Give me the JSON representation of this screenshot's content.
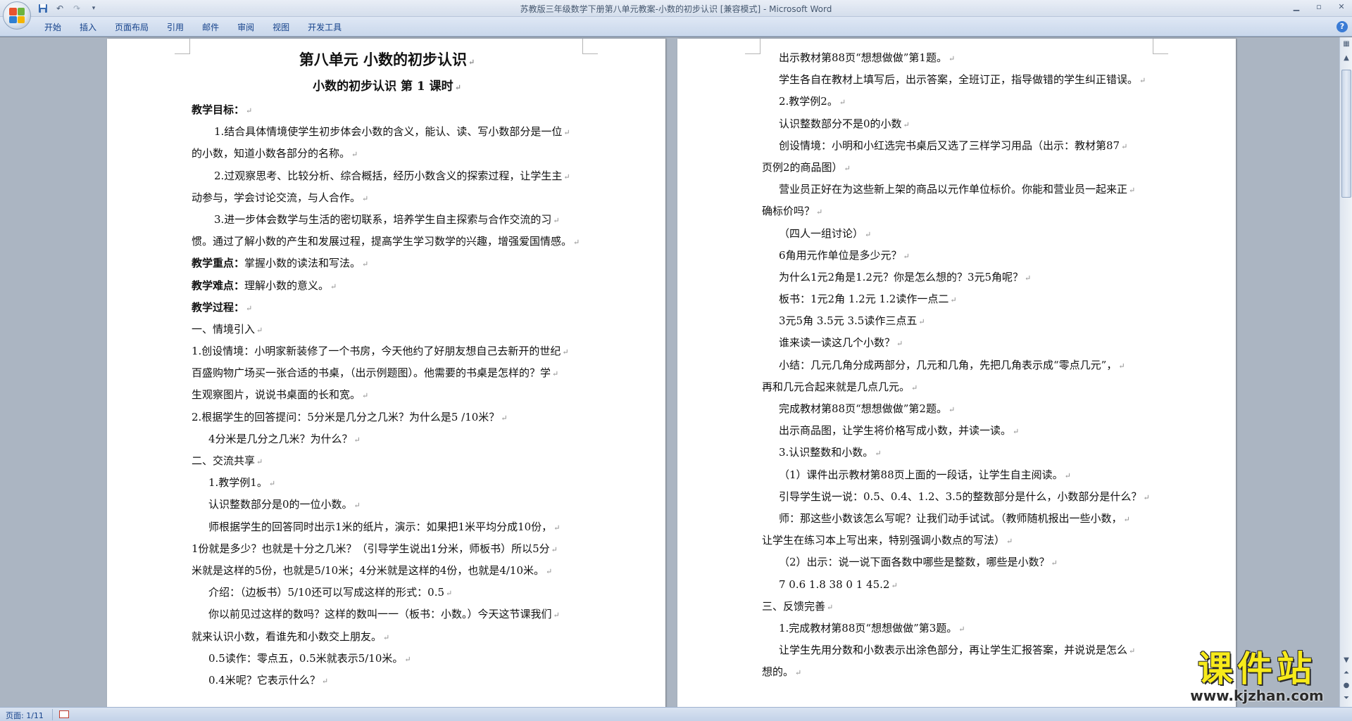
{
  "window": {
    "title": "苏教版三年级数学下册第八单元教案-小数的初步认识 [兼容模式] - Microsoft Word"
  },
  "qat": {
    "save_icon": "save-icon",
    "undo_icon": "undo-icon",
    "redo_icon": "redo-icon",
    "customize_icon": "chevron-down-icon"
  },
  "ribbon": {
    "tabs": [
      "开始",
      "插入",
      "页面布局",
      "引用",
      "邮件",
      "审阅",
      "视图",
      "开发工具"
    ]
  },
  "left_page": {
    "title": "第八单元  小数的初步认识",
    "subtitle": "小数的初步认识  第 1 课时",
    "lines": [
      {
        "text": "教学目标：",
        "style": "b"
      },
      {
        "text": "1.结合具体情境使学生初步体会小数的含义，能认、读、写小数部分是一位",
        "style": "ind2"
      },
      {
        "text": "的小数，知道小数各部分的名称。",
        "style": ""
      },
      {
        "text": "2.过观察思考、比较分析、综合概括，经历小数含义的探索过程，让学生主",
        "style": "ind2"
      },
      {
        "text": "动参与，学会讨论交流，与人合作。",
        "style": ""
      },
      {
        "text": "3.进一步体会数学与生活的密切联系，培养学生自主探索与合作交流的习",
        "style": "ind2"
      },
      {
        "text": "惯。通过了解小数的产生和发展过程，提高学生学习数学的兴趣，增强爱国情感。",
        "style": ""
      },
      {
        "text": "教学重点：掌握小数的读法和写法。",
        "style": "lead",
        "lead": "教学重点：",
        "rest": "掌握小数的读法和写法。"
      },
      {
        "text": "教学难点：理解小数的意义。",
        "style": "lead",
        "lead": "教学难点：",
        "rest": "理解小数的意义。"
      },
      {
        "text": "教学过程：",
        "style": "b"
      },
      {
        "text": "一、情境引入",
        "style": ""
      },
      {
        "text": "1.创设情境：小明家新装修了一个书房，今天他约了好朋友想自己去新开的世纪",
        "style": ""
      },
      {
        "text": "百盛购物广场买一张合适的书桌，（出示例题图）。他需要的书桌是怎样的？学",
        "style": ""
      },
      {
        "text": "生观察图片，说说书桌面的长和宽。",
        "style": ""
      },
      {
        "text": "2.根据学生的回答提问：5分米是几分之几米？为什么是5 /10米？",
        "style": ""
      },
      {
        "text": "4分米是几分之几米？为什么？",
        "style": "ind"
      },
      {
        "text": "二、交流共享",
        "style": ""
      },
      {
        "text": "1.教学例1。",
        "style": "ind"
      },
      {
        "text": "认识整数部分是0的一位小数。",
        "style": "ind"
      },
      {
        "text": "师根据学生的回答同时出示1米的纸片，演示：如果把1米平均分成10份，",
        "style": "ind"
      },
      {
        "text": "1份就是多少？也就是十分之几米？（引导学生说出1分米，师板书）所以5分",
        "style": ""
      },
      {
        "text": "米就是这样的5份，也就是5/10米；4分米就是这样的4份，也就是4/10米。",
        "style": ""
      },
      {
        "text": "介绍：（边板书）5/10还可以写成这样的形式：0.5",
        "style": "ind"
      },
      {
        "text": "你以前见过这样的数吗？这样的数叫一一（板书：小数。）今天这节课我们",
        "style": "ind"
      },
      {
        "text": "就来认识小数，看谁先和小数交上朋友。",
        "style": ""
      },
      {
        "text": "0.5读作：零点五，0.5米就表示5/10米。",
        "style": "ind"
      },
      {
        "text": "0.4米呢？它表示什么？",
        "style": "ind"
      }
    ]
  },
  "right_page": {
    "lines": [
      {
        "text": "出示教材第88页“想想做做”第1题。",
        "style": "ind"
      },
      {
        "text": "学生各自在教材上填写后，出示答案，全班订正，指导做错的学生纠正错误。",
        "style": "ind"
      },
      {
        "text": "2.教学例2。",
        "style": "ind"
      },
      {
        "text": "认识整数部分不是0的小数",
        "style": "ind"
      },
      {
        "text": "创设情境：小明和小红选完书桌后又选了三样学习用品（出示：教材第87",
        "style": "ind"
      },
      {
        "text": "页例2的商品图）",
        "style": ""
      },
      {
        "text": "营业员正好在为这些新上架的商品以元作单位标价。你能和营业员一起来正",
        "style": "ind"
      },
      {
        "text": "确标价吗？",
        "style": ""
      },
      {
        "text": "（四人一组讨论）",
        "style": "ind"
      },
      {
        "text": "6角用元作单位是多少元？",
        "style": "ind"
      },
      {
        "text": "为什么1元2角是1.2元？你是怎么想的？3元5角呢？",
        "style": "ind"
      },
      {
        "text": "板书：1元2角 1.2元 1.2读作一点二",
        "style": "ind"
      },
      {
        "text": "3元5角 3.5元 3.5读作三点五",
        "style": "ind"
      },
      {
        "text": "谁来读一读这几个小数？",
        "style": "ind"
      },
      {
        "text": "小结：几元几角分成两部分，几元和几角，先把几角表示成“零点几元”，",
        "style": "ind"
      },
      {
        "text": "再和几元合起来就是几点几元。",
        "style": ""
      },
      {
        "text": "完成教材第88页“想想做做”第2题。",
        "style": "ind"
      },
      {
        "text": "出示商品图，让学生将价格写成小数，并读一读。",
        "style": "ind"
      },
      {
        "text": "3.认识整数和小数。",
        "style": "ind"
      },
      {
        "text": "（1）课件出示教材第88页上面的一段话，让学生自主阅读。",
        "style": "ind"
      },
      {
        "text": "引导学生说一说：0.5、0.4、1.2、3.5的整数部分是什么，小数部分是什么？",
        "style": "ind"
      },
      {
        "text": "师：那这些小数该怎么写呢？让我们动手试试。（教师随机报出一些小数，",
        "style": "ind"
      },
      {
        "text": "让学生在练习本上写出来，特别强调小数点的写法）",
        "style": ""
      },
      {
        "text": "（2）出示：说一说下面各数中哪些是整数，哪些是小数？",
        "style": "ind"
      },
      {
        "text": "7 0.6 1.8 38 0 1 45.2",
        "style": "ind"
      },
      {
        "text": "三、反馈完善",
        "style": ""
      },
      {
        "text": "1.完成教材第88页“想想做做”第3题。",
        "style": "ind"
      },
      {
        "text": "让学生先用分数和小数表示出涂色部分，再让学生汇报答案，并说说是怎么",
        "style": "ind"
      },
      {
        "text": "想的。",
        "style": ""
      }
    ]
  },
  "status": {
    "page": "页面: 1/11"
  },
  "watermark": {
    "title": "课件站",
    "url": "www.kjzhan.com"
  },
  "colors": {
    "accent": "#15428b",
    "ribbon": "#c9d7eb",
    "workspace": "#abb5c2"
  }
}
